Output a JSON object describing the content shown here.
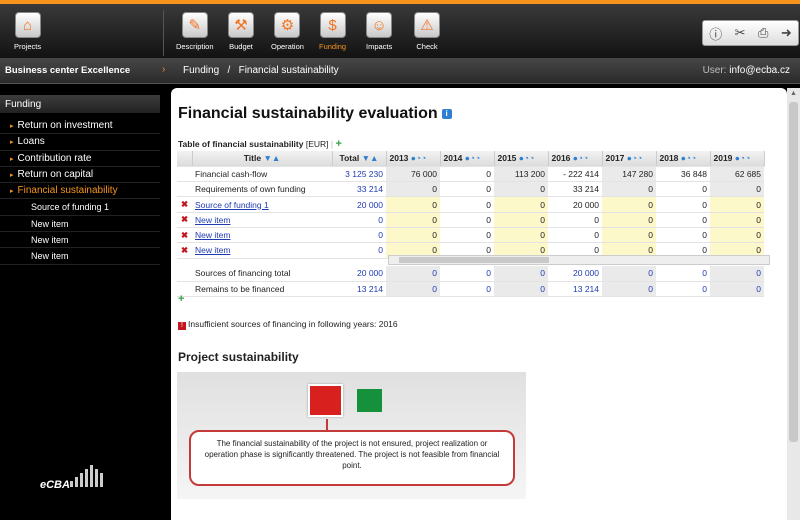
{
  "toolbar": {
    "projects": "Projects",
    "description": "Description",
    "budget": "Budget",
    "operation": "Operation",
    "funding": "Funding",
    "impacts": "Impacts",
    "check": "Check"
  },
  "breadcrumb": {
    "company": "Business center Excellence",
    "path": "Funding   /   Financial sustainability",
    "user_label": "User:",
    "user_email": "info@ecba.cz"
  },
  "sidebar": {
    "header": "Funding",
    "items": [
      "Return on investment",
      "Loans",
      "Contribution rate",
      "Return on capital",
      "Financial sustainability"
    ],
    "subitems": [
      "Source of funding 1",
      "New item",
      "New item",
      "New item"
    ]
  },
  "logo_text": "eCBA",
  "main": {
    "title": "Financial sustainability evaluation",
    "table_title": "Table of financial sustainability",
    "currency": "[EUR]",
    "headers": {
      "title": "Title",
      "total": "Total",
      "years": [
        "2013",
        "2014",
        "2015",
        "2016",
        "2017",
        "2018",
        "2019"
      ]
    },
    "rows": [
      {
        "title": "Financial cash-flow",
        "total": "3 125 230",
        "vals": [
          "76 000",
          "0",
          "113 200",
          "- 222 414",
          "147 280",
          "36 848",
          "62 685"
        ]
      },
      {
        "title": "Requirements of own funding",
        "total": "33 214",
        "vals": [
          "0",
          "0",
          "0",
          "33 214",
          "0",
          "0",
          "0"
        ]
      },
      {
        "title": "Source of funding 1",
        "total": "20 000",
        "vals": [
          "0",
          "0",
          "0",
          "20 000",
          "0",
          "0",
          "0"
        ]
      },
      {
        "title": "New item",
        "total": "0",
        "vals": [
          "0",
          "0",
          "0",
          "0",
          "0",
          "0",
          "0"
        ]
      },
      {
        "title": "New item",
        "total": "0",
        "vals": [
          "0",
          "0",
          "0",
          "0",
          "0",
          "0",
          "0"
        ]
      },
      {
        "title": "New item",
        "total": "0",
        "vals": [
          "0",
          "0",
          "0",
          "0",
          "0",
          "0",
          "0"
        ]
      }
    ],
    "summary": [
      {
        "title": "Sources of financing total",
        "total": "20 000",
        "vals": [
          "0",
          "0",
          "0",
          "20 000",
          "0",
          "0",
          "0"
        ]
      },
      {
        "title": "Remains to be financed",
        "total": "13 214",
        "vals": [
          "0",
          "0",
          "0",
          "13 214",
          "0",
          "0",
          "0"
        ]
      }
    ],
    "warning": "Insufficient sources of financing in following years: 2016",
    "ps_title": "Project sustainability",
    "ps_message": "The financial sustainability of the project is not ensured, project realization or operation phase is significantly threatened. The project is not feasible from financial point."
  }
}
